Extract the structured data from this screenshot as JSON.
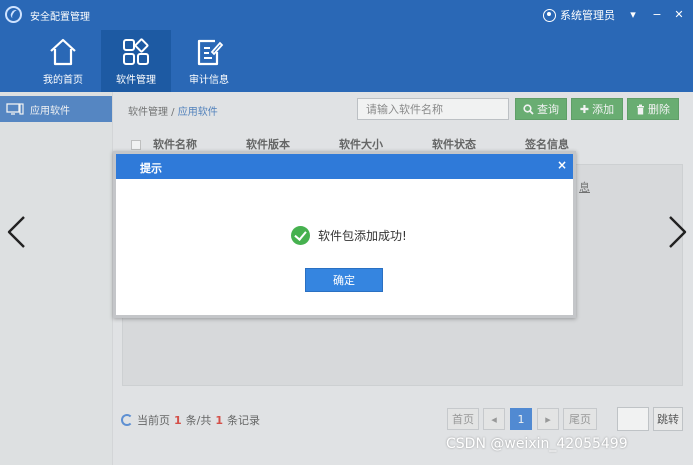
{
  "window": {
    "title": "安全配置管理",
    "user_label": "系统管理员",
    "menu_glyph": "▾",
    "minimize_glyph": "−",
    "close_glyph": "✕"
  },
  "topnav": {
    "items": [
      {
        "label": "我的首页",
        "icon": "home-icon"
      },
      {
        "label": "软件管理",
        "icon": "apps-grid-icon"
      },
      {
        "label": "审计信息",
        "icon": "edit-document-icon"
      }
    ],
    "active_index": 1
  },
  "sidebar": {
    "items": [
      {
        "label": "应用软件",
        "icon": "monitor-icon"
      }
    ]
  },
  "breadcrumb": {
    "parent": "软件管理 /",
    "current": "应用软件"
  },
  "toolbar": {
    "search_placeholder": "请输入软件名称",
    "search_label": "查询",
    "add_label": "添加",
    "delete_label": "删除"
  },
  "table": {
    "columns": [
      "软件名称",
      "软件版本",
      "软件大小",
      "软件状态",
      "签名信息"
    ],
    "detail_link": "息"
  },
  "pagination": {
    "current_page_label": "当前页",
    "current_page": "1",
    "total_label": "条/共",
    "total_count": "1",
    "records_label": "条记录",
    "first_label": "首页",
    "prev_glyph": "◂",
    "page_number": "1",
    "next_glyph": "▸",
    "last_label": "尾页",
    "jump_label": "跳转"
  },
  "dialog": {
    "title": "提示",
    "close_glyph": "×",
    "message": "软件包添加成功!",
    "ok_label": "确定"
  },
  "watermark": "CSDN @weixin_42055499",
  "colors": {
    "header_blue": "#2a68b6",
    "active_blue": "#1d5aa3",
    "success_green": "#46b14f",
    "button_green": "#4aa355",
    "dialog_blue": "#2f7ad9",
    "accent_red": "#d8261d"
  }
}
